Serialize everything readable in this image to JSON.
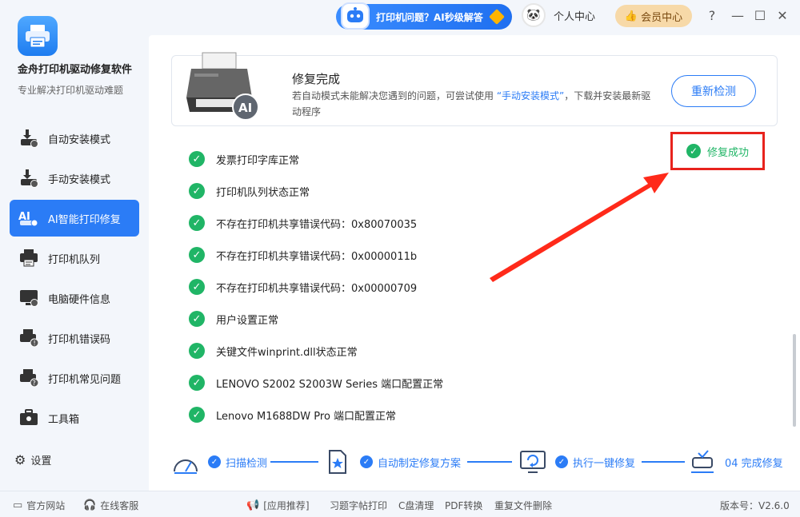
{
  "app": {
    "title": "金舟打印机驱动修复软件",
    "subtitle": "专业解决打印机驱动难题"
  },
  "sidebar": {
    "items": [
      {
        "label": "自动安装模式",
        "icon": "download-printer-icon",
        "active": false
      },
      {
        "label": "手动安装模式",
        "icon": "manual-install-icon",
        "active": false
      },
      {
        "label": "AI智能打印修复",
        "icon": "ai-repair-icon",
        "active": true
      },
      {
        "label": "打印机队列",
        "icon": "printer-queue-icon",
        "active": false
      },
      {
        "label": "电脑硬件信息",
        "icon": "monitor-icon",
        "active": false
      },
      {
        "label": "打印机错误码",
        "icon": "error-code-icon",
        "active": false
      },
      {
        "label": "打印机常见问题",
        "icon": "faq-icon",
        "active": false
      },
      {
        "label": "工具箱",
        "icon": "toolbox-icon",
        "active": false
      }
    ],
    "settings_label": "设置"
  },
  "topbar": {
    "ai_help_label": "打印机问题？AI秒级解答",
    "user_center_label": "个人中心",
    "vip_label": "会员中心"
  },
  "banner": {
    "title": "修复完成",
    "desc_part1": "若自动模式未能解决您遇到的问题，可尝试使用 ",
    "desc_highlight": "“手动安装模式”",
    "desc_part2": "，下载并安装最新驱动程序",
    "recheck_label": "重新检测"
  },
  "results": [
    "发票打印字库正常",
    "打印机队列状态正常",
    "不存在打印机共享错误代码：0x80070035",
    "不存在打印机共享错误代码：0x0000011b",
    "不存在打印机共享错误代码：0x00000709",
    "用户设置正常",
    "关键文件winprint.dll状态正常",
    "LENOVO S2002 S2003W Series 端口配置正常",
    "Lenovo M1688DW Pro 端口配置正常"
  ],
  "success_label": "修复成功",
  "steps": [
    {
      "label": "扫描检测",
      "icon": "scan-gauge-icon"
    },
    {
      "label": "自动制定修复方案",
      "icon": "plan-doc-icon"
    },
    {
      "label": "执行一键修复",
      "icon": "repair-monitor-icon"
    },
    {
      "label": "04 完成修复",
      "icon": "complete-printer-icon"
    }
  ],
  "footer": {
    "website_label": "官方网站",
    "service_label": "在线客服",
    "recommend_label": "[应用推荐]",
    "links": [
      "习题字帖打印",
      "C盘清理",
      "PDF转换",
      "重复文件删除"
    ],
    "version_label": "版本号：V2.6.0"
  },
  "colors": {
    "accent": "#2b7cf6",
    "success": "#20b566",
    "highlight_red": "#e8231d"
  }
}
